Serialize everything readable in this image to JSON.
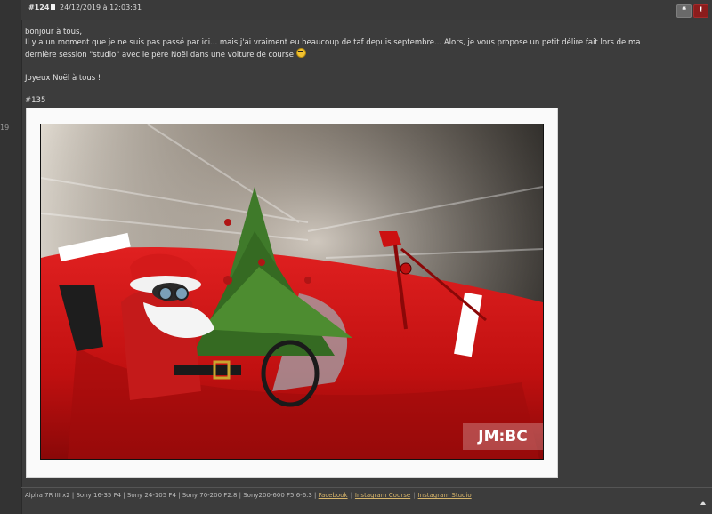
{
  "gutter": {
    "number": "19"
  },
  "post": {
    "number": "#124",
    "date": "24/12/2019 à 12:03:31",
    "quote_symbol": "❝",
    "report_symbol": "!",
    "greeting": "bonjour à tous,",
    "line1": "Il y a un moment que je ne suis pas passé par ici... mais j'ai vraiment eu beaucoup de taf depuis septembre... Alors, je vous propose un petit délire fait lors de ma",
    "line2": "dernière session \"studio\" avec le père Noël dans une voiture de course",
    "wish": "Joyeux Noël à tous !",
    "photo_ref": "#135",
    "watermark": "JM:BC"
  },
  "signature": {
    "gear": "Alpha 7R III x2 | Sony 16-35 F4 | Sony 24-105 F4 | Sony 70-200 F2.8 | Sony200-600 F5.6-6.3 |",
    "links": [
      "Facebook",
      "Instagram Course",
      "Instagram Studio"
    ]
  },
  "colors": {
    "background": "#3c3c3c",
    "link": "#d6b46a",
    "report_button": "#8b1c1c"
  }
}
